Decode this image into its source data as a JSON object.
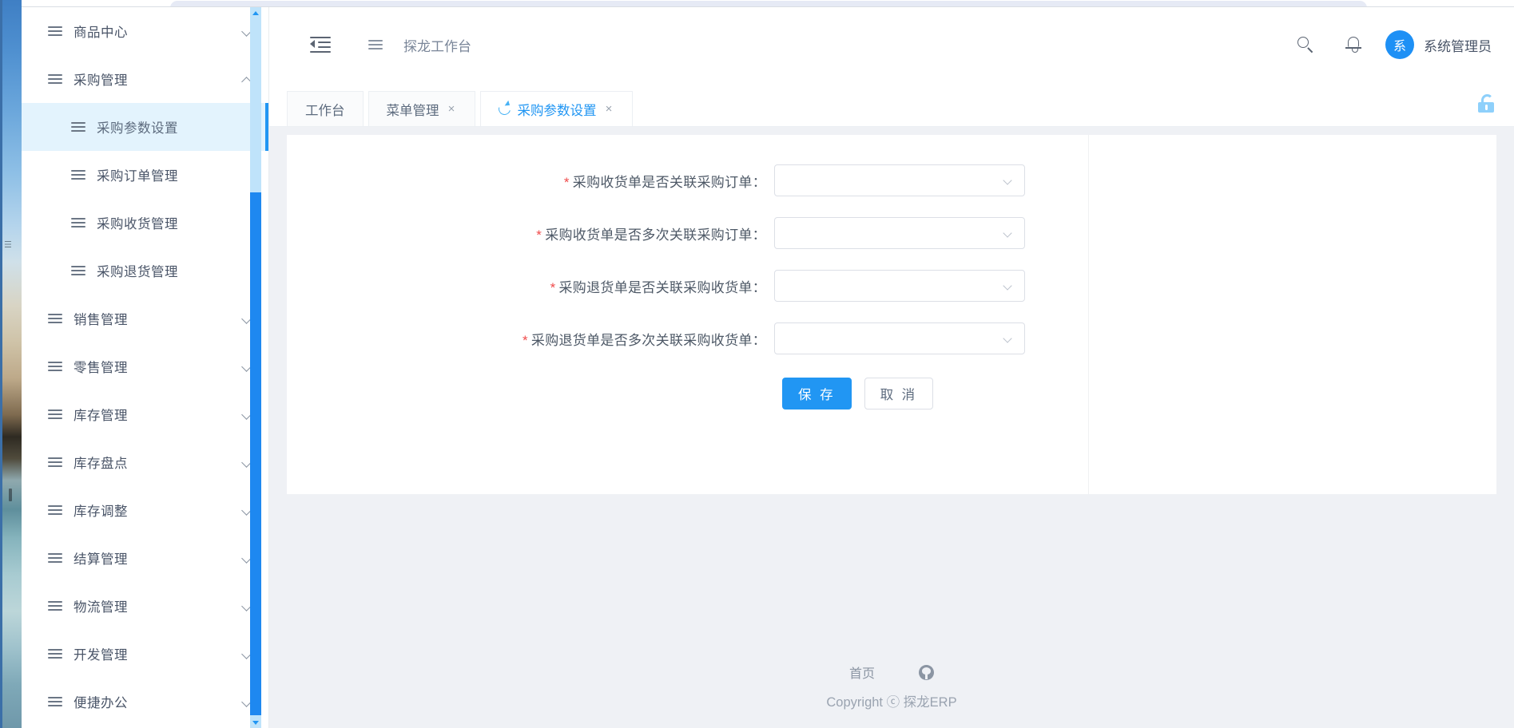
{
  "app": {
    "brand": "探龙ERP",
    "workbench_title": "探龙工作台"
  },
  "sidebar": {
    "items": [
      {
        "label": "商品中心",
        "level": "parent",
        "state": "collapsed",
        "icon": "menu-icon"
      },
      {
        "label": "采购管理",
        "level": "parent",
        "state": "expanded",
        "icon": "menu-icon"
      },
      {
        "label": "采购参数设置",
        "level": "child",
        "state": "active",
        "icon": "menu-icon"
      },
      {
        "label": "采购订单管理",
        "level": "child",
        "state": "normal",
        "icon": "menu-icon"
      },
      {
        "label": "采购收货管理",
        "level": "child",
        "state": "normal",
        "icon": "menu-icon"
      },
      {
        "label": "采购退货管理",
        "level": "child",
        "state": "normal",
        "icon": "menu-icon"
      },
      {
        "label": "销售管理",
        "level": "parent",
        "state": "collapsed",
        "icon": "menu-icon"
      },
      {
        "label": "零售管理",
        "level": "parent",
        "state": "collapsed",
        "icon": "menu-icon"
      },
      {
        "label": "库存管理",
        "level": "parent",
        "state": "collapsed",
        "icon": "menu-icon"
      },
      {
        "label": "库存盘点",
        "level": "parent",
        "state": "collapsed",
        "icon": "menu-icon"
      },
      {
        "label": "库存调整",
        "level": "parent",
        "state": "collapsed",
        "icon": "menu-icon"
      },
      {
        "label": "结算管理",
        "level": "parent",
        "state": "collapsed",
        "icon": "menu-icon"
      },
      {
        "label": "物流管理",
        "level": "parent",
        "state": "collapsed",
        "icon": "menu-icon"
      },
      {
        "label": "开发管理",
        "level": "parent",
        "state": "collapsed",
        "icon": "menu-icon"
      },
      {
        "label": "便捷办公",
        "level": "parent",
        "state": "collapsed",
        "icon": "menu-icon"
      }
    ]
  },
  "topbar": {
    "collapse_icon": "menu-fold-icon",
    "breadcrumb_icon": "menu-icon",
    "breadcrumb": "探龙工作台",
    "search_icon": "search-icon",
    "bell_icon": "bell-icon",
    "avatar_initial": "系",
    "user_name": "系统管理员"
  },
  "tabs": {
    "lock_icon": "unlock-icon",
    "items": [
      {
        "label": "工作台",
        "closable": false,
        "active": false,
        "loading": false
      },
      {
        "label": "菜单管理",
        "closable": true,
        "active": false,
        "loading": false,
        "close": "×"
      },
      {
        "label": "采购参数设置",
        "closable": true,
        "active": true,
        "loading": true,
        "close": "×",
        "spinner_icon": "refresh-icon"
      }
    ]
  },
  "form": {
    "required_marker": "*",
    "rows": [
      {
        "label": "采购收货单是否关联采购订单：",
        "value": "",
        "placeholder": "",
        "icon": "chevron-down-icon"
      },
      {
        "label": "采购收货单是否多次关联采购订单：",
        "value": "",
        "placeholder": "",
        "icon": "chevron-down-icon"
      },
      {
        "label": "采购退货单是否关联采购收货单：",
        "value": "",
        "placeholder": "",
        "icon": "chevron-down-icon"
      },
      {
        "label": "采购退货单是否多次关联采购收货单：",
        "value": "",
        "placeholder": "",
        "icon": "chevron-down-icon"
      }
    ],
    "save_label": "保 存",
    "cancel_label": "取 消"
  },
  "footer": {
    "home_link": "首页",
    "github_icon": "github-icon",
    "copyright": "Copyright ⓒ 探龙ERP"
  },
  "colors": {
    "accent": "#2196f3",
    "active_menu_bg": "#e3f3fd",
    "required_star": "#f04b4b",
    "page_bg": "#eff1f5",
    "lock": "#8ed0fb"
  }
}
